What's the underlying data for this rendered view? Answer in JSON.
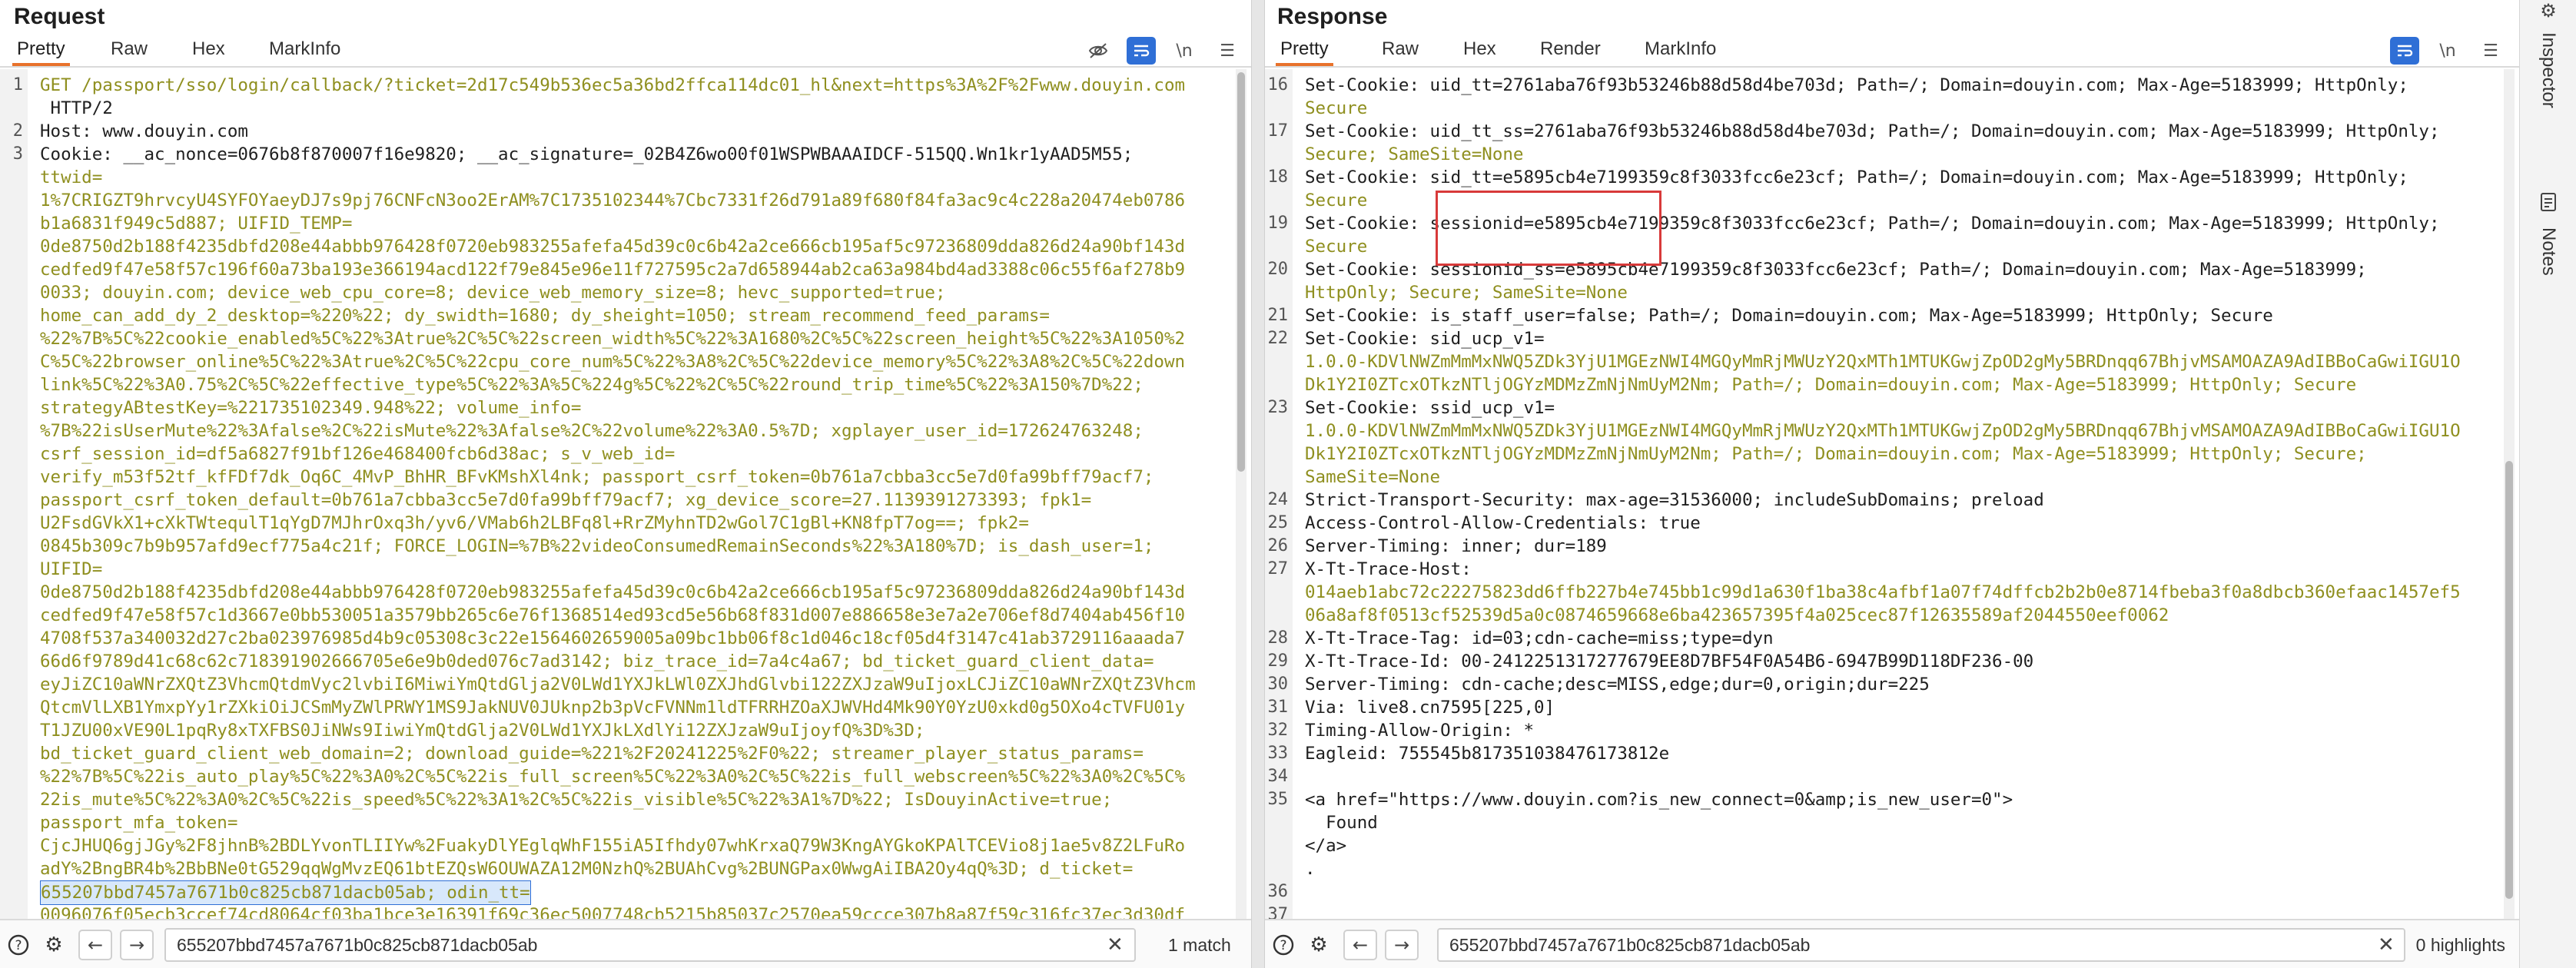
{
  "request": {
    "title": "Request",
    "tabs": [
      "Pretty",
      "Raw",
      "Hex",
      "MarkInfo"
    ],
    "active_tab": "Pretty",
    "tools": [
      "eye-off-icon",
      "wrap-icon",
      "newline-icon",
      "menu-icon"
    ],
    "lines": [
      {
        "n": "1",
        "text": "GET /passport/sso/login/callback/?ticket=2d17c549b536ec5a36bd2ffca114dc01_hl&next=https%3A%2F%2Fwww.douyin.com"
      },
      {
        "n": "",
        "text": " HTTP/2"
      },
      {
        "n": "2",
        "text": "Host: www.douyin.com"
      },
      {
        "n": "3",
        "text": "Cookie: __ac_nonce=0676b8f870007f16e9820; __ac_signature=_02B4Z6wo00f01WSPWBAAAIDCF-515QQ.Wn1kr1yAAD5M55;"
      },
      {
        "n": "",
        "text": "ttwid="
      },
      {
        "n": "",
        "text": "1%7CRIGZT9hrvcyU4SYFOYaeyDJ7s9pj76CNFcN3oo2ErAM%7C1735102344%7Cbc7331f26d791a89f680f84fa3ac9c4c228a20474eb0786"
      },
      {
        "n": "",
        "text": "b1a6831f949c5d887; UIFID_TEMP="
      },
      {
        "n": "",
        "text": "0de8750d2b188f4235dbfd208e44abbb976428f0720eb983255afefa45d39c0c6b42a2ce666cb195af5c97236809dda826d24a90bf143d"
      },
      {
        "n": "",
        "text": "cedfed9f47e58f57c196f60a73ba193e366194acd122f79e845e96e11f727595c2a7d658944ab2ca63a984bd4ad3388c06c55f6af278b9"
      },
      {
        "n": "",
        "text": "0033; douyin.com; device_web_cpu_core=8; device_web_memory_size=8; hevc_supported=true;"
      },
      {
        "n": "",
        "text": "home_can_add_dy_2_desktop=%220%22; dy_swidth=1680; dy_sheight=1050; stream_recommend_feed_params="
      },
      {
        "n": "",
        "text": "%22%7B%5C%22cookie_enabled%5C%22%3Atrue%2C%5C%22screen_width%5C%22%3A1680%2C%5C%22screen_height%5C%22%3A1050%2"
      },
      {
        "n": "",
        "text": "C%5C%22browser_online%5C%22%3Atrue%2C%5C%22cpu_core_num%5C%22%3A8%2C%5C%22device_memory%5C%22%3A8%2C%5C%22down"
      },
      {
        "n": "",
        "text": "link%5C%22%3A0.75%2C%5C%22effective_type%5C%22%3A%5C%224g%5C%22%2C%5C%22round_trip_time%5C%22%3A150%7D%22;"
      },
      {
        "n": "",
        "text": "strategyABtestKey=%221735102349.948%22; volume_info="
      },
      {
        "n": "",
        "text": "%7B%22isUserMute%22%3Afalse%2C%22isMute%22%3Afalse%2C%22volume%22%3A0.5%7D; xgplayer_user_id=172624763248;"
      },
      {
        "n": "",
        "text": "csrf_session_id=df5a6827f91bf126e468400fcb6d38ac; s_v_web_id="
      },
      {
        "n": "",
        "text": "verify_m53f52tf_kfFDf7dk_Oq6C_4MvP_BhHR_BFvKMshXl4nk; passport_csrf_token=0b761a7cbba3cc5e7d0fa99bff79acf7;"
      },
      {
        "n": "",
        "text": "passport_csrf_token_default=0b761a7cbba3cc5e7d0fa99bff79acf7; xg_device_score=27.1139391273393; fpk1="
      },
      {
        "n": "",
        "text": "U2FsdGVkX1+cXkTWtequlT1qYgD7MJhrOxq3h/yv6/VMab6h2LBFq8l+RrZMyhnTD2wGol7C1gBl+KN8fpT7og==; fpk2="
      },
      {
        "n": "",
        "text": "0845b309c7b9b957afd9ecf775a4c21f; FORCE_LOGIN=%7B%22videoConsumedRemainSeconds%22%3A180%7D; is_dash_user=1;"
      },
      {
        "n": "",
        "text": "UIFID="
      },
      {
        "n": "",
        "text": "0de8750d2b188f4235dbfd208e44abbb976428f0720eb983255afefa45d39c0c6b42a2ce666cb195af5c97236809dda826d24a90bf143d"
      },
      {
        "n": "",
        "text": "cedfed9f47e58f57c1d3667e0bb530051a3579bb265c6e76f1368514ed93cd5e56b68f831d007e886658e3e7a2e706ef8d7404ab456f10"
      },
      {
        "n": "",
        "text": "4708f537a340032d27c2ba023976985d4b9c05308c3c22e1564602659005a09bc1bb06f8c1d046c18cf05d4f3147c41ab3729116aaada7"
      },
      {
        "n": "",
        "text": "66d6f9789d41c68c62c718391902666705e6e9b0ded076c7ad3142; biz_trace_id=7a4c4a67; bd_ticket_guard_client_data="
      },
      {
        "n": "",
        "text": "eyJiZC10aWNrZXQtZ3VhcmQtdmVyc2lvbiI6MiwiYmQtdGlja2V0LWd1YXJkLWl0ZXJhdGlvbi122ZXJzaW9uIjoxLCJiZC10aWNrZXQtZ3Vhcm"
      },
      {
        "n": "",
        "text": "QtcmVlLXB1YmxpYy1rZXkiOiJCSmMyZWlPRWY1MS9JakNUV0JUknp2b3pVcFVNNm1ldTFRRHZOaXJWVHd4Mk90Y0YzU0xkd0g5OXo4cTVFU01y"
      },
      {
        "n": "",
        "text": "T1JZU00xVE90L1pqRy8xTXFBS0JiNWs9IiwiYmQtdGlja2V0LWd1YXJkLXdlYi12ZXJzaW9uIjoyfQ%3D%3D;"
      },
      {
        "n": "",
        "text": "bd_ticket_guard_client_web_domain=2; download_guide=%221%2F20241225%2F0%22; streamer_player_status_params="
      },
      {
        "n": "",
        "text": "%22%7B%5C%22is_auto_play%5C%22%3A0%2C%5C%22is_full_screen%5C%22%3A0%2C%5C%22is_full_webscreen%5C%22%3A0%2C%5C%"
      },
      {
        "n": "",
        "text": "22is_mute%5C%22%3A0%2C%5C%22is_speed%5C%22%3A1%2C%5C%22is_visible%5C%22%3A1%7D%22; IsDouyinActive=true;"
      },
      {
        "n": "",
        "text": "passport_mfa_token="
      },
      {
        "n": "",
        "text": "CjcJHUQ6gjJGy%2F8jhnB%2BDLYvonTLIIYw%2FuakyDlYEglqWhF155iA5Ifhdy07whKrxaQ79W3KngAYGkoKPAlTCEVio8j1ae5v8Z2LFuRo"
      },
      {
        "n": "",
        "text": "adY%2BngBR4b%2BbBNe0tG529qqWgMvzEQ61btEZQsW6OUWAZA12M0NzhQ%2BUAhCvg%2BUNGPax0WwgAiIBA2Oy4qQ%3D; d_ticket="
      },
      {
        "n": "",
        "text": "655207bbd7457a7671b0c825cb871dacb05ab; odin_tt="
      },
      {
        "n": "",
        "text": "0096076f05ecb3ccef74cd8064cf03ba1bce3e16391f69c36ec5007748cb5215b85037c2570ea59ccce307b8a87f59c316fc37ec3d30df"
      }
    ],
    "search": {
      "value": "655207bbd7457a7671b0c825cb871dacb05ab",
      "result": "1 match"
    }
  },
  "response": {
    "title": "Response",
    "tabs": [
      "Pretty",
      "Raw",
      "Hex",
      "Render",
      "MarkInfo"
    ],
    "active_tab": "Pretty",
    "tools": [
      "wrap-icon",
      "newline-icon",
      "menu-icon"
    ],
    "lines": [
      {
        "n": "16",
        "text": "Set-Cookie: uid_tt=2761aba76f93b53246b88d58d4be703d; Path=/; Domain=douyin.com; Max-Age=5183999; HttpOnly;"
      },
      {
        "n": "",
        "text": "Secure"
      },
      {
        "n": "17",
        "text": "Set-Cookie: uid_tt_ss=2761aba76f93b53246b88d58d4be703d; Path=/; Domain=douyin.com; Max-Age=5183999; HttpOnly;"
      },
      {
        "n": "",
        "text": "Secure; SameSite=None"
      },
      {
        "n": "18",
        "text": "Set-Cookie: sid_tt=e5895cb4e7199359c8f3033fcc6e23cf; Path=/; Domain=douyin.com; Max-Age=5183999; HttpOnly;"
      },
      {
        "n": "",
        "text": "Secure"
      },
      {
        "n": "19",
        "text": "Set-Cookie: sessionid=e5895cb4e7199359c8f3033fcc6e23cf; Path=/; Domain=douyin.com; Max-Age=5183999; HttpOnly;"
      },
      {
        "n": "",
        "text": "Secure"
      },
      {
        "n": "20",
        "text": "Set-Cookie: sessionid_ss=e5895cb4e7199359c8f3033fcc6e23cf; Path=/; Domain=douyin.com; Max-Age=5183999;"
      },
      {
        "n": "",
        "text": "HttpOnly; Secure; SameSite=None"
      },
      {
        "n": "21",
        "text": "Set-Cookie: is_staff_user=false; Path=/; Domain=douyin.com; Max-Age=5183999; HttpOnly; Secure"
      },
      {
        "n": "22",
        "text": "Set-Cookie: sid_ucp_v1="
      },
      {
        "n": "",
        "text": "1.0.0-KDVlNWZmMmMxNWQ5ZDk3YjU1MGEzNWI4MGQyMmRjMWUzY2QxMTh1MTUKGwjZpOD2gMy5BRDnqq67BhjvMSAMOAZA9AdIBBoCaGwiIGU1O"
      },
      {
        "n": "",
        "text": "Dk1Y2I0ZTcxOTkzNTljOGYzMDMzZmNjNmUyM2Nm; Path=/; Domain=douyin.com; Max-Age=5183999; HttpOnly; Secure"
      },
      {
        "n": "23",
        "text": "Set-Cookie: ssid_ucp_v1="
      },
      {
        "n": "",
        "text": "1.0.0-KDVlNWZmMmMxNWQ5ZDk3YjU1MGEzNWI4MGQyMmRjMWUzY2QxMTh1MTUKGwjZpOD2gMy5BRDnqq67BhjvMSAMOAZA9AdIBBoCaGwiIGU1O"
      },
      {
        "n": "",
        "text": "Dk1Y2I0ZTcxOTkzNTljOGYzMDMzZmNjNmUyM2Nm; Path=/; Domain=douyin.com; Max-Age=5183999; HttpOnly; Secure;"
      },
      {
        "n": "",
        "text": "SameSite=None"
      },
      {
        "n": "24",
        "text": "Strict-Transport-Security: max-age=31536000; includeSubDomains; preload"
      },
      {
        "n": "25",
        "text": "Access-Control-Allow-Credentials: true"
      },
      {
        "n": "26",
        "text": "Server-Timing: inner; dur=189"
      },
      {
        "n": "27",
        "text": "X-Tt-Trace-Host:"
      },
      {
        "n": "",
        "text": "014aeb1abc72c22275823dd6ffb227b4e745bb1c99d1a630f1ba38c4afbf1a07f74dffcb2b2b0e8714fbeba3f0a8dbcb360efaac1457ef5"
      },
      {
        "n": "",
        "text": "06a8af8f0513cf52539d5a0c0874659668e6ba423657395f4a025cec87f12635589af2044550eef0062"
      },
      {
        "n": "28",
        "text": "X-Tt-Trace-Tag: id=03;cdn-cache=miss;type=dyn"
      },
      {
        "n": "29",
        "text": "X-Tt-Trace-Id: 00-2412251317277679EE8D7BF54F0A54B6-6947B99D118DF236-00"
      },
      {
        "n": "30",
        "text": "Server-Timing: cdn-cache;desc=MISS,edge;dur=0,origin;dur=225"
      },
      {
        "n": "31",
        "text": "Via: live8.cn7595[225,0]"
      },
      {
        "n": "32",
        "text": "Timing-Allow-Origin: *"
      },
      {
        "n": "33",
        "text": "Eagleid: 755545b817351038476173812e"
      },
      {
        "n": "34",
        "text": ""
      },
      {
        "n": "35",
        "text": "<a href=\"https://www.douyin.com?is_new_connect=0&amp;is_new_user=0\">"
      },
      {
        "n": "",
        "text": "  Found"
      },
      {
        "n": "",
        "text": "</a>"
      },
      {
        "n": "",
        "text": "."
      },
      {
        "n": "36",
        "text": ""
      },
      {
        "n": "37",
        "text": ""
      }
    ],
    "search": {
      "value": "655207bbd7457a7671b0c825cb871dacb05ab",
      "result": "0 highlights"
    }
  },
  "rail": {
    "items": [
      "Inspector",
      "Notes"
    ]
  },
  "colors": {
    "accent": "#e8722b",
    "key": "#1f1f1f",
    "value": "#8f8f1f",
    "link": "#1f64c8",
    "highlight_box": "#d83a3a"
  }
}
